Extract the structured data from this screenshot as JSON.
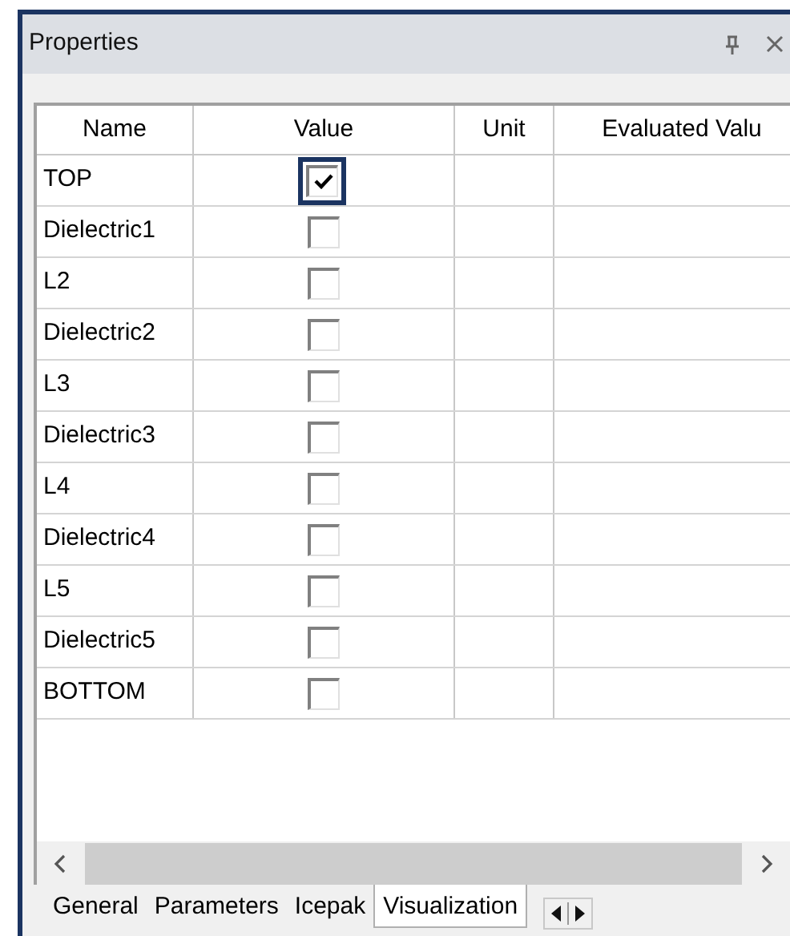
{
  "panel": {
    "title": "Properties"
  },
  "table": {
    "columns": [
      "Name",
      "Value",
      "Unit",
      "Evaluated Valu"
    ],
    "rows": [
      {
        "name": "TOP",
        "checked": true,
        "focused": true
      },
      {
        "name": "Dielectric1",
        "checked": false,
        "focused": false
      },
      {
        "name": "L2",
        "checked": false,
        "focused": false
      },
      {
        "name": "Dielectric2",
        "checked": false,
        "focused": false
      },
      {
        "name": "L3",
        "checked": false,
        "focused": false
      },
      {
        "name": "Dielectric3",
        "checked": false,
        "focused": false
      },
      {
        "name": "L4",
        "checked": false,
        "focused": false
      },
      {
        "name": "Dielectric4",
        "checked": false,
        "focused": false
      },
      {
        "name": "L5",
        "checked": false,
        "focused": false
      },
      {
        "name": "Dielectric5",
        "checked": false,
        "focused": false
      },
      {
        "name": "BOTTOM",
        "checked": false,
        "focused": false
      }
    ]
  },
  "tabs": [
    {
      "label": "General",
      "selected": false
    },
    {
      "label": "Parameters",
      "selected": false
    },
    {
      "label": "Icepak",
      "selected": false
    },
    {
      "label": "Visualization",
      "selected": true
    }
  ]
}
